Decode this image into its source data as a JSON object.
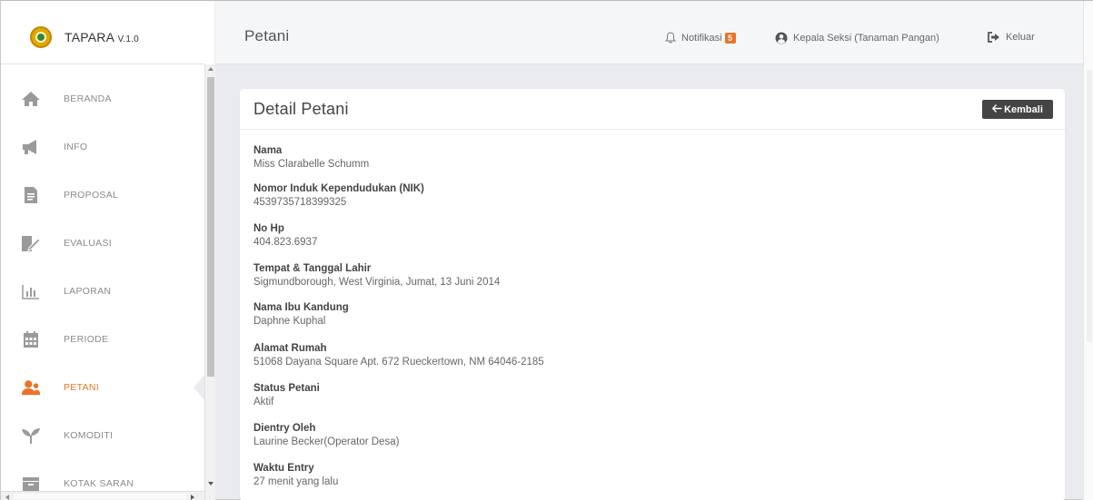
{
  "brand": {
    "name": "TAPARA",
    "version": "V.1.0"
  },
  "header": {
    "page_title": "Petani",
    "notifications_label": "Notifikasi",
    "notifications_count": "5",
    "user_label": "Kepala Seksi (Tanaman Pangan)",
    "logout_label": "Keluar"
  },
  "sidebar": {
    "items": [
      {
        "label": "BERANDA",
        "icon": "home-icon"
      },
      {
        "label": "INFO",
        "icon": "megaphone-icon"
      },
      {
        "label": "PROPOSAL",
        "icon": "document-icon"
      },
      {
        "label": "EVALUASI",
        "icon": "edit-document-icon"
      },
      {
        "label": "LAPORAN",
        "icon": "bar-chart-icon"
      },
      {
        "label": "PERIODE",
        "icon": "calendar-icon"
      },
      {
        "label": "PETANI",
        "icon": "users-icon",
        "active": true
      },
      {
        "label": "KOMODITI",
        "icon": "sprout-icon"
      },
      {
        "label": "KOTAK SARAN",
        "icon": "inbox-icon"
      }
    ]
  },
  "card": {
    "title": "Detail Petani",
    "back_label": "Kembali"
  },
  "fields": [
    {
      "label": "Nama",
      "value": "Miss Clarabelle Schumm"
    },
    {
      "label": "Nomor Induk Kependudukan (NIK)",
      "value": "4539735718399325"
    },
    {
      "label": "No Hp",
      "value": "404.823.6937"
    },
    {
      "label": "Tempat & Tanggal Lahir",
      "value": "Sigmundborough, West Virginia, Jumat, 13 Juni 2014"
    },
    {
      "label": "Nama Ibu Kandung",
      "value": "Daphne Kuphal"
    },
    {
      "label": "Alamat Rumah",
      "value": "51068 Dayana Square Apt. 672 Rueckertown, NM 64046-2185"
    },
    {
      "label": "Status Petani",
      "value": "Aktif"
    },
    {
      "label": "Dientry Oleh",
      "value": "Laurine Becker(Operator Desa)"
    },
    {
      "label": "Waktu Entry",
      "value": "27 menit yang lalu"
    }
  ],
  "colors": {
    "accent": "#e8742c",
    "menu_text": "#8a8a8a",
    "icon_gray": "#9a9a9a",
    "back_button": "#444444"
  }
}
